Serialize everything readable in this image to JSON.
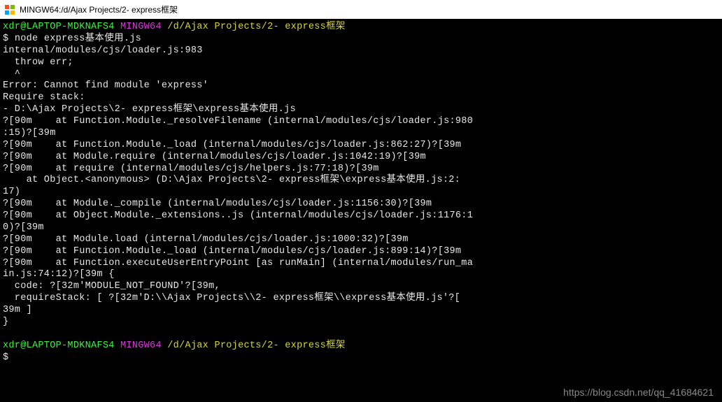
{
  "titlebar": {
    "title": "MINGW64:/d/Ajax Projects/2- express框架"
  },
  "prompt": {
    "user_host": "xdr@LAPTOP-MDKNAFS4",
    "env": "MINGW64",
    "path": "/d/Ajax Projects/2- express框架",
    "dollar": "$"
  },
  "command": "node express基本使用.js",
  "output": {
    "l1": "internal/modules/cjs/loader.js:983",
    "l2": "  throw err;",
    "l3": "  ^",
    "l4": "",
    "l5": "Error: Cannot find module 'express'",
    "l6": "Require stack:",
    "l7": "- D:\\Ajax Projects\\2- express框架\\express基本使用.js",
    "l8": "?[90m    at Function.Module._resolveFilename (internal/modules/cjs/loader.js:980",
    "l9": ":15)?[39m",
    "l10": "?[90m    at Function.Module._load (internal/modules/cjs/loader.js:862:27)?[39m",
    "l11": "?[90m    at Module.require (internal/modules/cjs/loader.js:1042:19)?[39m",
    "l12": "?[90m    at require (internal/modules/cjs/helpers.js:77:18)?[39m",
    "l13": "    at Object.<anonymous> (D:\\Ajax Projects\\2- express框架\\express基本使用.js:2:",
    "l14": "17)",
    "l15": "?[90m    at Module._compile (internal/modules/cjs/loader.js:1156:30)?[39m",
    "l16": "?[90m    at Object.Module._extensions..js (internal/modules/cjs/loader.js:1176:1",
    "l17": "0)?[39m",
    "l18": "?[90m    at Module.load (internal/modules/cjs/loader.js:1000:32)?[39m",
    "l19": "?[90m    at Function.Module._load (internal/modules/cjs/loader.js:899:14)?[39m",
    "l20": "?[90m    at Function.executeUserEntryPoint [as runMain] (internal/modules/run_ma",
    "l21": "in.js:74:12)?[39m {",
    "l22": "  code: ?[32m'MODULE_NOT_FOUND'?[39m,",
    "l23": "  requireStack: [ ?[32m'D:\\\\Ajax Projects\\\\2- express框架\\\\express基本使用.js'?[",
    "l24": "39m ]",
    "l25": "}"
  },
  "watermark": "https://blog.csdn.net/qq_41684621"
}
